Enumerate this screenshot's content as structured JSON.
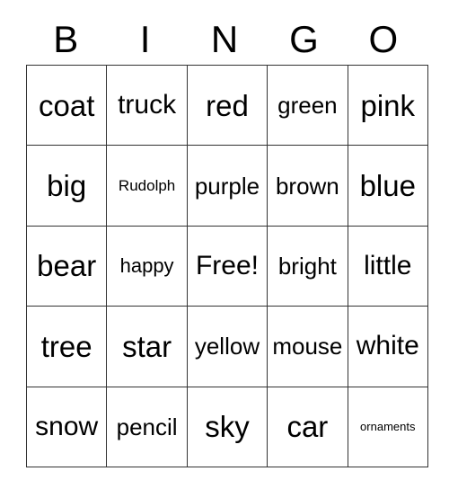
{
  "card": {
    "headers": [
      "B",
      "I",
      "N",
      "G",
      "O"
    ],
    "rows": [
      [
        {
          "label": "coat",
          "size": "sz-xl"
        },
        {
          "label": "truck",
          "size": "sz-lg"
        },
        {
          "label": "red",
          "size": "sz-xl"
        },
        {
          "label": "green",
          "size": "sz-md"
        },
        {
          "label": "pink",
          "size": "sz-xl"
        }
      ],
      [
        {
          "label": "big",
          "size": "sz-xl"
        },
        {
          "label": "Rudolph",
          "size": "sz-xs"
        },
        {
          "label": "purple",
          "size": "sz-md"
        },
        {
          "label": "brown",
          "size": "sz-md"
        },
        {
          "label": "blue",
          "size": "sz-xl"
        }
      ],
      [
        {
          "label": "bear",
          "size": "sz-xl"
        },
        {
          "label": "happy",
          "size": "sz-sm"
        },
        {
          "label": "Free!",
          "size": "sz-lg"
        },
        {
          "label": "bright",
          "size": "sz-md"
        },
        {
          "label": "little",
          "size": "sz-lg"
        }
      ],
      [
        {
          "label": "tree",
          "size": "sz-xl"
        },
        {
          "label": "star",
          "size": "sz-xl"
        },
        {
          "label": "yellow",
          "size": "sz-md"
        },
        {
          "label": "mouse",
          "size": "sz-md"
        },
        {
          "label": "white",
          "size": "sz-lg"
        }
      ],
      [
        {
          "label": "snow",
          "size": "sz-lg"
        },
        {
          "label": "pencil",
          "size": "sz-md"
        },
        {
          "label": "sky",
          "size": "sz-xl"
        },
        {
          "label": "car",
          "size": "sz-xl"
        },
        {
          "label": "ornaments",
          "size": "sz-xxs"
        }
      ]
    ],
    "colors": {
      "border": "#333333",
      "text": "#000000",
      "background": "#ffffff"
    }
  }
}
